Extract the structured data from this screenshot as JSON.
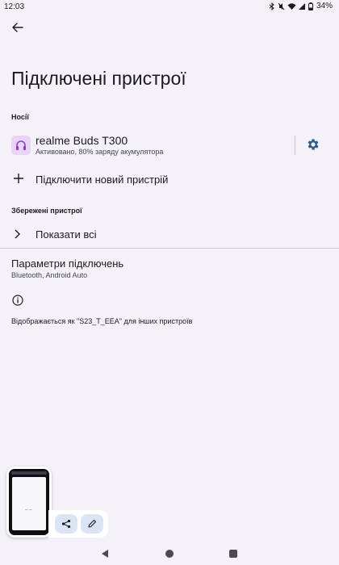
{
  "status_bar": {
    "time": "12:03",
    "battery": "34%",
    "icons": [
      "bluetooth-icon",
      "mute-icon",
      "wifi-icon",
      "signal-icon",
      "battery-icon"
    ]
  },
  "page": {
    "title": "Підключені пристрої"
  },
  "media_section": {
    "header": "Носії",
    "device": {
      "name": "realme Buds T300",
      "status": "Активовано, 80% заряду акумулятора",
      "icon": "headphones-icon",
      "settings_icon": "gear-icon"
    }
  },
  "add_device": {
    "label": "Підключити новий пристрій",
    "icon": "plus-icon"
  },
  "saved_section": {
    "header": "Збережені пристрої",
    "show_all_label": "Показати всі"
  },
  "connection_prefs": {
    "title": "Параметри підключень",
    "subtitle": "Bluetooth, Android Auto"
  },
  "visibility": {
    "text": "Відображається як \"S23_T_EEA\" для інших пристроїв",
    "icon": "info-icon"
  },
  "screenshot_preview": {
    "actions": [
      "share-icon",
      "edit-icon"
    ]
  },
  "colors": {
    "background": "#f4f1f8",
    "accent": "#2f5d8c",
    "device_icon_bg": "#e8d4f6",
    "device_icon": "#8a3fc0"
  }
}
